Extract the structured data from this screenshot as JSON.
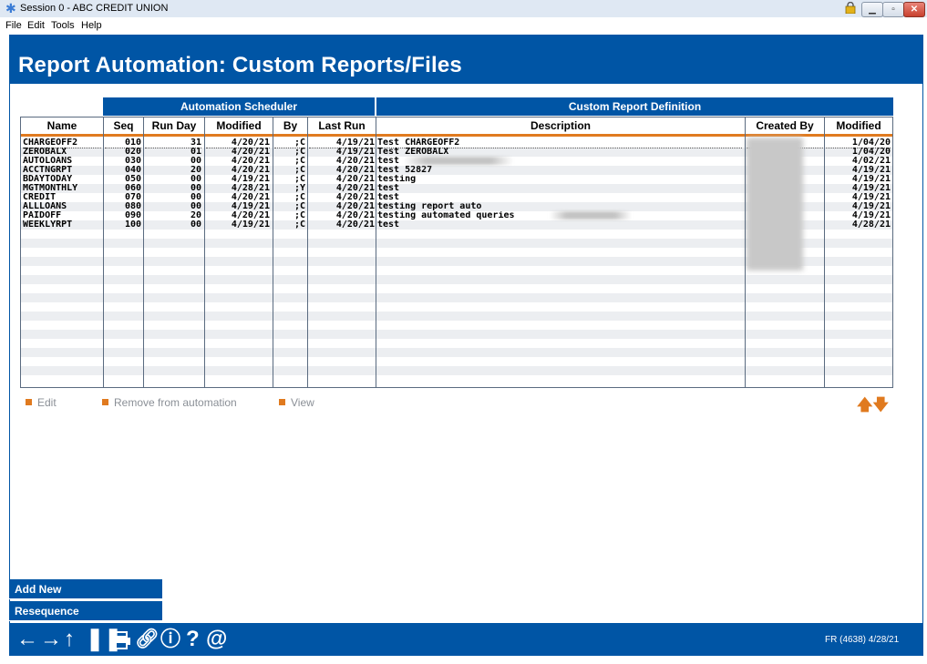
{
  "window": {
    "title": "Session 0 - ABC CREDIT UNION",
    "menu": [
      "File",
      "Edit",
      "Tools",
      "Help"
    ]
  },
  "page": {
    "title": "Report Automation: Custom Reports/Files"
  },
  "table": {
    "group_headers": {
      "scheduler": "Automation Scheduler",
      "definition": "Custom Report Definition"
    },
    "columns": [
      "Name",
      "Seq",
      "Run Day",
      "Modified",
      "By",
      "Last Run",
      "Description",
      "Created By",
      "Modified"
    ],
    "rows": [
      {
        "name": "CHARGEOFF2",
        "seq": "010",
        "run_day": "31",
        "modified": "4/20/21",
        "by": ";C",
        "last_run": "4/19/21",
        "description": "Test CHARGEOFF2",
        "created_by": "",
        "def_modified": "1/04/20"
      },
      {
        "name": "ZEROBALX",
        "seq": "020",
        "run_day": "01",
        "modified": "4/20/21",
        "by": ";C",
        "last_run": "4/19/21",
        "description": "Test ZEROBALX",
        "created_by": "",
        "def_modified": "1/04/20"
      },
      {
        "name": "AUTOLOANS",
        "seq": "030",
        "run_day": "00",
        "modified": "4/20/21",
        "by": ";C",
        "last_run": "4/20/21",
        "description": "test",
        "created_by": "",
        "def_modified": "4/02/21"
      },
      {
        "name": "ACCTNGRPT",
        "seq": "040",
        "run_day": "20",
        "modified": "4/20/21",
        "by": ";C",
        "last_run": "4/20/21",
        "description": "test 52827",
        "created_by": "",
        "def_modified": "4/19/21"
      },
      {
        "name": "BDAYTODAY",
        "seq": "050",
        "run_day": "00",
        "modified": "4/19/21",
        "by": ";C",
        "last_run": "4/20/21",
        "description": "testing",
        "created_by": "",
        "def_modified": "4/19/21"
      },
      {
        "name": "MGTMONTHLY",
        "seq": "060",
        "run_day": "00",
        "modified": "4/28/21",
        "by": ";Y",
        "last_run": "4/20/21",
        "description": "test",
        "created_by": "",
        "def_modified": "4/19/21"
      },
      {
        "name": "CREDIT",
        "seq": "070",
        "run_day": "00",
        "modified": "4/20/21",
        "by": ";C",
        "last_run": "4/20/21",
        "description": "test",
        "created_by": "",
        "def_modified": "4/19/21"
      },
      {
        "name": "ALLLOANS",
        "seq": "080",
        "run_day": "00",
        "modified": "4/19/21",
        "by": ";C",
        "last_run": "4/20/21",
        "description": "testing report auto",
        "created_by": "",
        "def_modified": "4/19/21"
      },
      {
        "name": "PAIDOFF",
        "seq": "090",
        "run_day": "20",
        "modified": "4/20/21",
        "by": ";C",
        "last_run": "4/20/21",
        "description": "testing automated queries",
        "created_by": "",
        "def_modified": "4/19/21"
      },
      {
        "name": "WEEKLYRPT",
        "seq": "100",
        "run_day": "00",
        "modified": "4/19/21",
        "by": ";C",
        "last_run": "4/20/21",
        "description": "test",
        "created_by": "",
        "def_modified": "4/28/21"
      }
    ]
  },
  "actions": {
    "edit": "Edit",
    "remove": "Remove from automation",
    "view": "View",
    "up_arrow": "🡅",
    "down_arrow": "🡇"
  },
  "side_buttons": {
    "add_new": "Add New",
    "resequence": "Resequence"
  },
  "footer": {
    "code": "FR (4638) 4/28/21",
    "icons": [
      "back-arrow-icon",
      "forward-arrow-icon",
      "up-arrow-icon",
      "pause-icon",
      "print-icon",
      "link-icon",
      "info-icon",
      "help-icon",
      "at-icon"
    ]
  },
  "colors": {
    "brand_blue": "#0055a5",
    "accent_orange": "#e07a1f"
  }
}
